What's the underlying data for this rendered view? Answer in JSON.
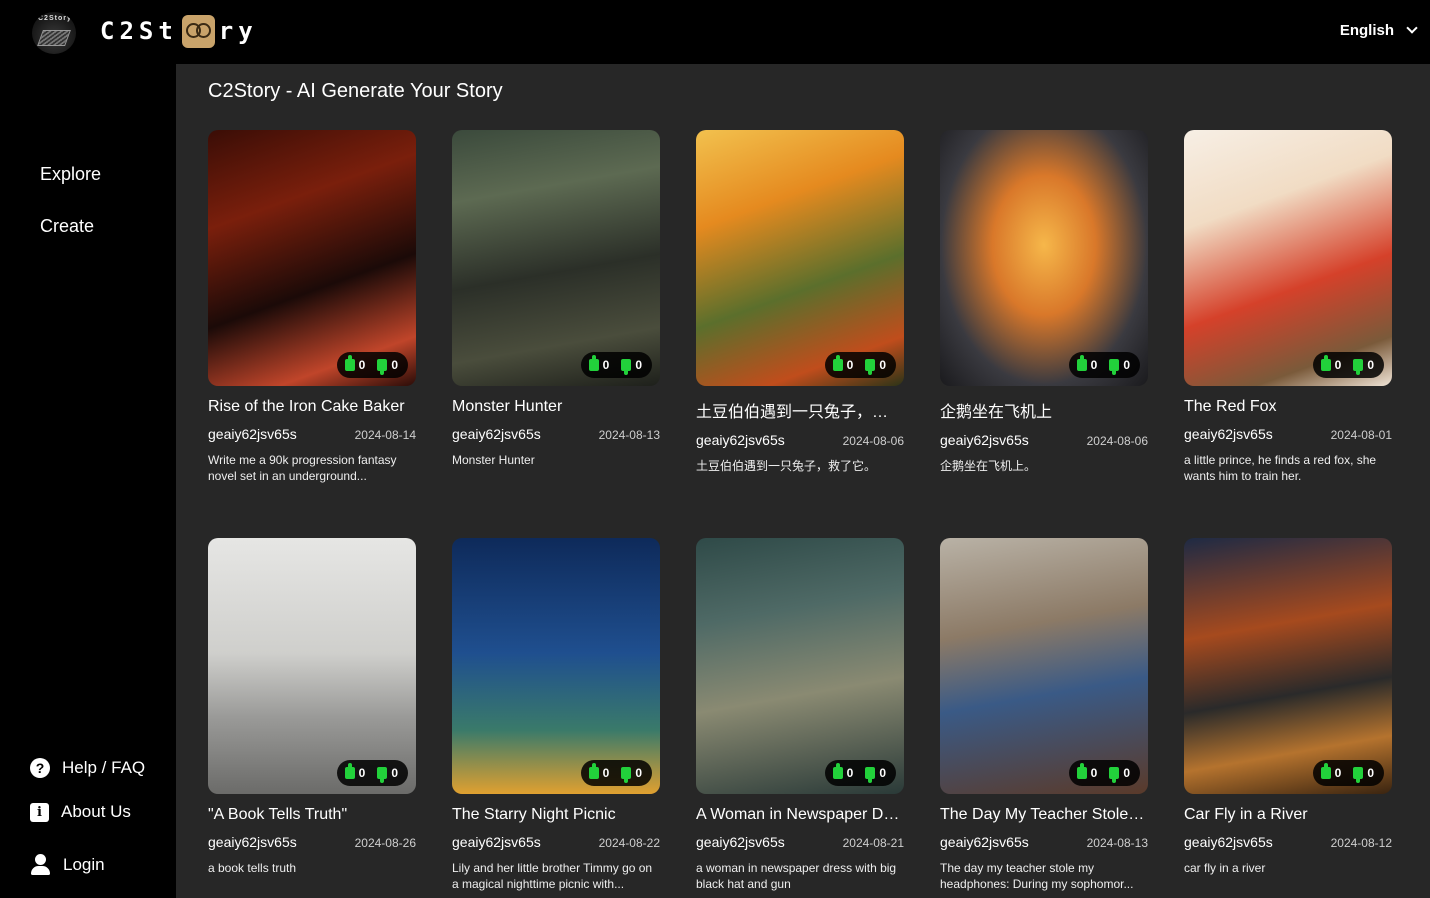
{
  "header": {
    "logo_text_prefix": "C2St",
    "logo_text_suffix": "ry",
    "logo_badge_text": "C2Story",
    "language": "English"
  },
  "sidebar": {
    "nav": [
      {
        "label": "Explore"
      },
      {
        "label": "Create"
      }
    ],
    "help_label": "Help / FAQ",
    "about_label": "About Us",
    "login_label": "Login"
  },
  "main": {
    "title": "C2Story - AI Generate Your Story",
    "cards": [
      {
        "title": "Rise of the Iron Cake Baker",
        "author": "geaiy62jsv65s",
        "date": "2024-08-14",
        "desc": "Write me a 90k progression fantasy novel set in an underground...",
        "likes": "0",
        "dislikes": "0",
        "image": "dwarf-warrior-with-cake",
        "bg": "linear-gradient(160deg,#3a0d06 0%,#7a1f0c 30%,#1b0a08 60%,#c0452a 85%,#2a0c08 100%)"
      },
      {
        "title": "Monster Hunter",
        "author": "geaiy62jsv65s",
        "date": "2024-08-13",
        "desc": "Monster Hunter",
        "likes": "0",
        "dislikes": "0",
        "image": "dragon-monster",
        "bg": "linear-gradient(170deg,#3b4a3c 0%,#5d6a52 25%,#2b2f28 55%,#4a4d3c 80%,#1e201b 100%)"
      },
      {
        "title": "土豆伯伯遇到一只兔子，救了它。",
        "author": "geaiy62jsv65s",
        "date": "2024-08-06",
        "desc": "土豆伯伯遇到一只兔子，救了它。",
        "likes": "0",
        "dislikes": "0",
        "image": "old-man-and-rabbit",
        "bg": "linear-gradient(160deg,#f2c14e 0%,#e58a1f 30%,#5b6f2c 60%,#c04d1c 85%,#2c3417 100%)"
      },
      {
        "title": "企鹅坐在飞机上",
        "author": "geaiy62jsv65s",
        "date": "2024-08-06",
        "desc": "企鹅坐在飞机上。",
        "likes": "0",
        "dislikes": "0",
        "image": "penguin-in-airplane-window",
        "bg": "radial-gradient(ellipse at 50% 45%,#f6b74a 0%,#d9782a 35%,#3a3a40 70%,#1a1a1d 100%)"
      },
      {
        "title": "The Red Fox",
        "author": "geaiy62jsv65s",
        "date": "2024-08-01",
        "desc": "a little prince, he finds a red fox, she wants him to train her.",
        "likes": "0",
        "dislikes": "0",
        "image": "prince-with-fox",
        "bg": "linear-gradient(160deg,#f7efe5 0%,#f1dcc4 30%,#d5412a 60%,#7a5a3a 85%,#f0e4d6 100%)"
      },
      {
        "title": "\"A Book Tells Truth\"",
        "author": "geaiy62jsv65s",
        "date": "2024-08-26",
        "desc": "a book tells truth",
        "likes": "0",
        "dislikes": "0",
        "image": "book-truth-unveiled",
        "bg": "linear-gradient(180deg,#e6e6e4 0%,#cfcfcc 45%,#9a9a98 70%,#6b6b69 100%)"
      },
      {
        "title": "The Starry Night Picnic",
        "author": "geaiy62jsv65s",
        "date": "2024-08-22",
        "desc": "Lily and her little brother Timmy go on a magical nighttime picnic with...",
        "likes": "0",
        "dislikes": "0",
        "image": "kids-starry-picnic",
        "bg": "linear-gradient(180deg,#0e2a5a 0%,#1f4f8f 45%,#3a7a6a 75%,#e0a030 100%)"
      },
      {
        "title": "A Woman in Newspaper Dress",
        "author": "geaiy62jsv65s",
        "date": "2024-08-21",
        "desc": "a woman in newspaper dress with big black hat and gun",
        "likes": "0",
        "dislikes": "0",
        "image": "woman-newspaper-dress",
        "bg": "linear-gradient(170deg,#2f4a48 0%,#4f6a66 30%,#8a8a72 60%,#2a3a38 100%)"
      },
      {
        "title": "The Day My Teacher Stole My Headphones",
        "author": "geaiy62jsv65s",
        "date": "2024-08-13",
        "desc": "The day my teacher stole my headphones: During my sophomor...",
        "likes": "0",
        "dislikes": "0",
        "image": "student-headphones-classroom",
        "bg": "linear-gradient(170deg,#b9b2a6 0%,#8c7a66 35%,#3a5a86 60%,#5a3a2a 100%)"
      },
      {
        "title": "Car Fly in a River",
        "author": "geaiy62jsv65s",
        "date": "2024-08-12",
        "desc": "car fly in a river",
        "likes": "0",
        "dislikes": "0",
        "image": "car-splashing-river",
        "bg": "linear-gradient(170deg,#1e2a44 0%,#a64a1e 35%,#2a2a2a 60%,#b5732e 80%,#3a2410 100%)"
      }
    ]
  }
}
